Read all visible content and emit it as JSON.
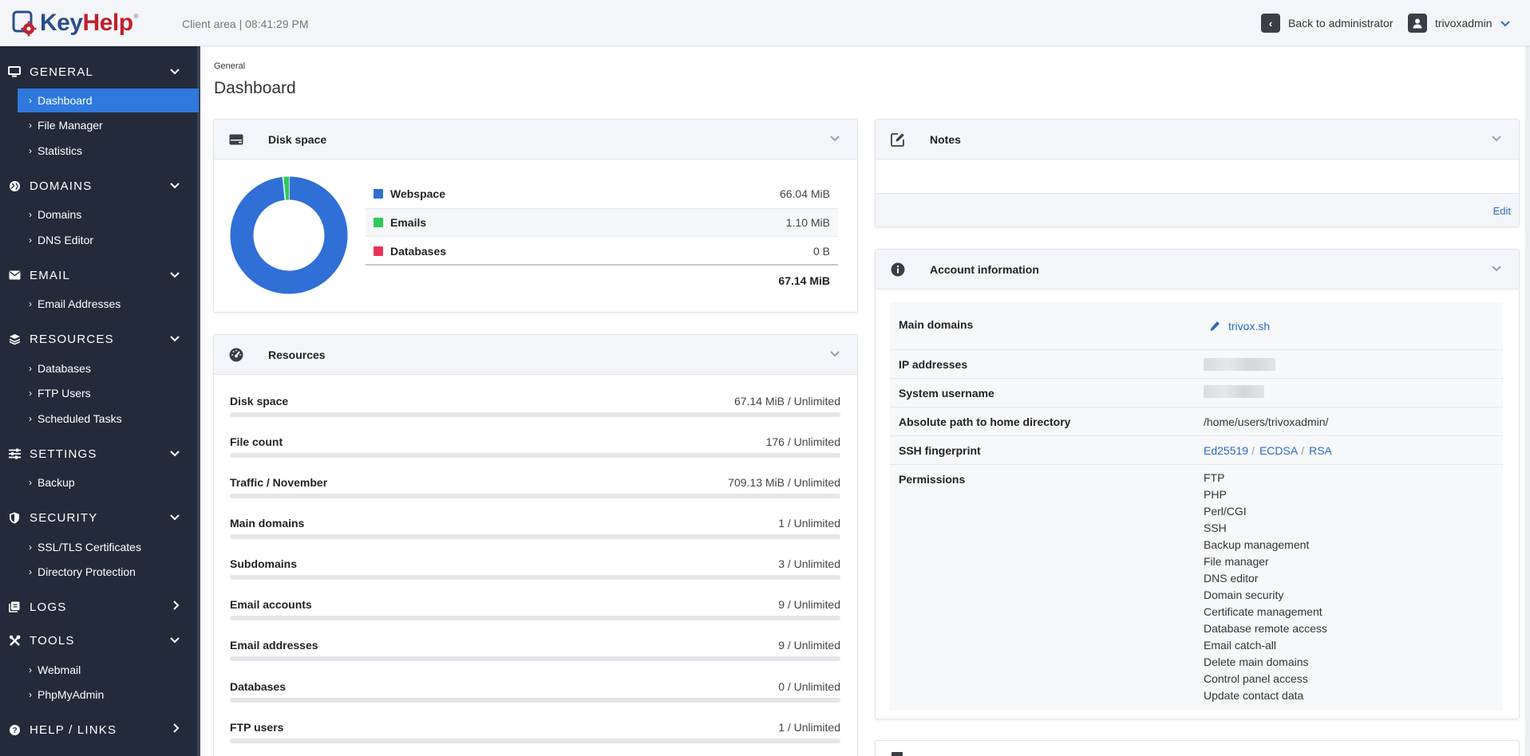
{
  "header": {
    "logo_key": "Key",
    "logo_help": "Help",
    "logo_reg": "®",
    "client_area": "Client area | 08:41:29 PM",
    "back_label": "Back to administrator",
    "username": "trivoxadmin"
  },
  "sidebar": {
    "sections": [
      {
        "label": "GENERAL",
        "icon": "monitor-icon",
        "items": [
          "Dashboard",
          "File Manager",
          "Statistics"
        ]
      },
      {
        "label": "DOMAINS",
        "icon": "globe-icon",
        "items": [
          "Domains",
          "DNS Editor"
        ]
      },
      {
        "label": "EMAIL",
        "icon": "envelope-icon",
        "items": [
          "Email Addresses"
        ]
      },
      {
        "label": "RESOURCES",
        "icon": "layers-icon",
        "items": [
          "Databases",
          "FTP Users",
          "Scheduled Tasks"
        ]
      },
      {
        "label": "SETTINGS",
        "icon": "sliders-icon",
        "items": [
          "Backup"
        ]
      },
      {
        "label": "SECURITY",
        "icon": "shield-icon",
        "items": [
          "SSL/TLS Certificates",
          "Directory Protection"
        ]
      },
      {
        "label": "LOGS",
        "icon": "log-icon",
        "items": []
      },
      {
        "label": "TOOLS",
        "icon": "tools-icon",
        "items": [
          "Webmail",
          "PhpMyAdmin"
        ]
      },
      {
        "label": "HELP / LINKS",
        "icon": "question-icon",
        "items": []
      }
    ],
    "active_item": "Dashboard"
  },
  "page": {
    "breadcrumb": "General",
    "title": "Dashboard"
  },
  "disk": {
    "title": "Disk space",
    "rows": [
      {
        "name": "Webspace",
        "value": "66.04 MiB",
        "color": "#2f6fd6"
      },
      {
        "name": "Emails",
        "value": "1.10 MiB",
        "color": "#2fc95a"
      },
      {
        "name": "Databases",
        "value": "0 B",
        "color": "#e8345a"
      }
    ],
    "total": "67.14 MiB"
  },
  "chart_data": {
    "type": "pie",
    "categories": [
      "Webspace",
      "Emails",
      "Databases"
    ],
    "values": [
      66.04,
      1.1,
      0
    ]
  },
  "resources": {
    "title": "Resources",
    "rows": [
      {
        "label": "Disk space",
        "value": "67.14 MiB / Unlimited"
      },
      {
        "label": "File count",
        "value": "176 / Unlimited"
      },
      {
        "label": "Traffic / November",
        "value": "709.13 MiB / Unlimited"
      },
      {
        "label": "Main domains",
        "value": "1 / Unlimited"
      },
      {
        "label": "Subdomains",
        "value": "3 / Unlimited"
      },
      {
        "label": "Email accounts",
        "value": "9 / Unlimited"
      },
      {
        "label": "Email addresses",
        "value": "9 / Unlimited"
      },
      {
        "label": "Databases",
        "value": "0 / Unlimited"
      },
      {
        "label": "FTP users",
        "value": "1 / Unlimited"
      }
    ]
  },
  "notes": {
    "title": "Notes",
    "edit": "Edit"
  },
  "account": {
    "title": "Account information",
    "main_domains_label": "Main domains",
    "main_domain": "trivox.sh",
    "ip_label": "IP addresses",
    "sysuser_label": "System username",
    "home_label": "Absolute path to home directory",
    "home_value": "/home/users/trivoxadmin/",
    "ssh_label": "SSH fingerprint",
    "ssh_keys": [
      "Ed25519",
      "ECDSA",
      "RSA"
    ],
    "ssh_sep": "/",
    "perm_label": "Permissions",
    "permissions": [
      "FTP",
      "PHP",
      "Perl/CGI",
      "SSH",
      "Backup management",
      "File manager",
      "DNS editor",
      "Domain security",
      "Certificate management",
      "Database remote access",
      "Email catch-all",
      "Delete main domains",
      "Control panel access",
      "Update contact data"
    ]
  }
}
